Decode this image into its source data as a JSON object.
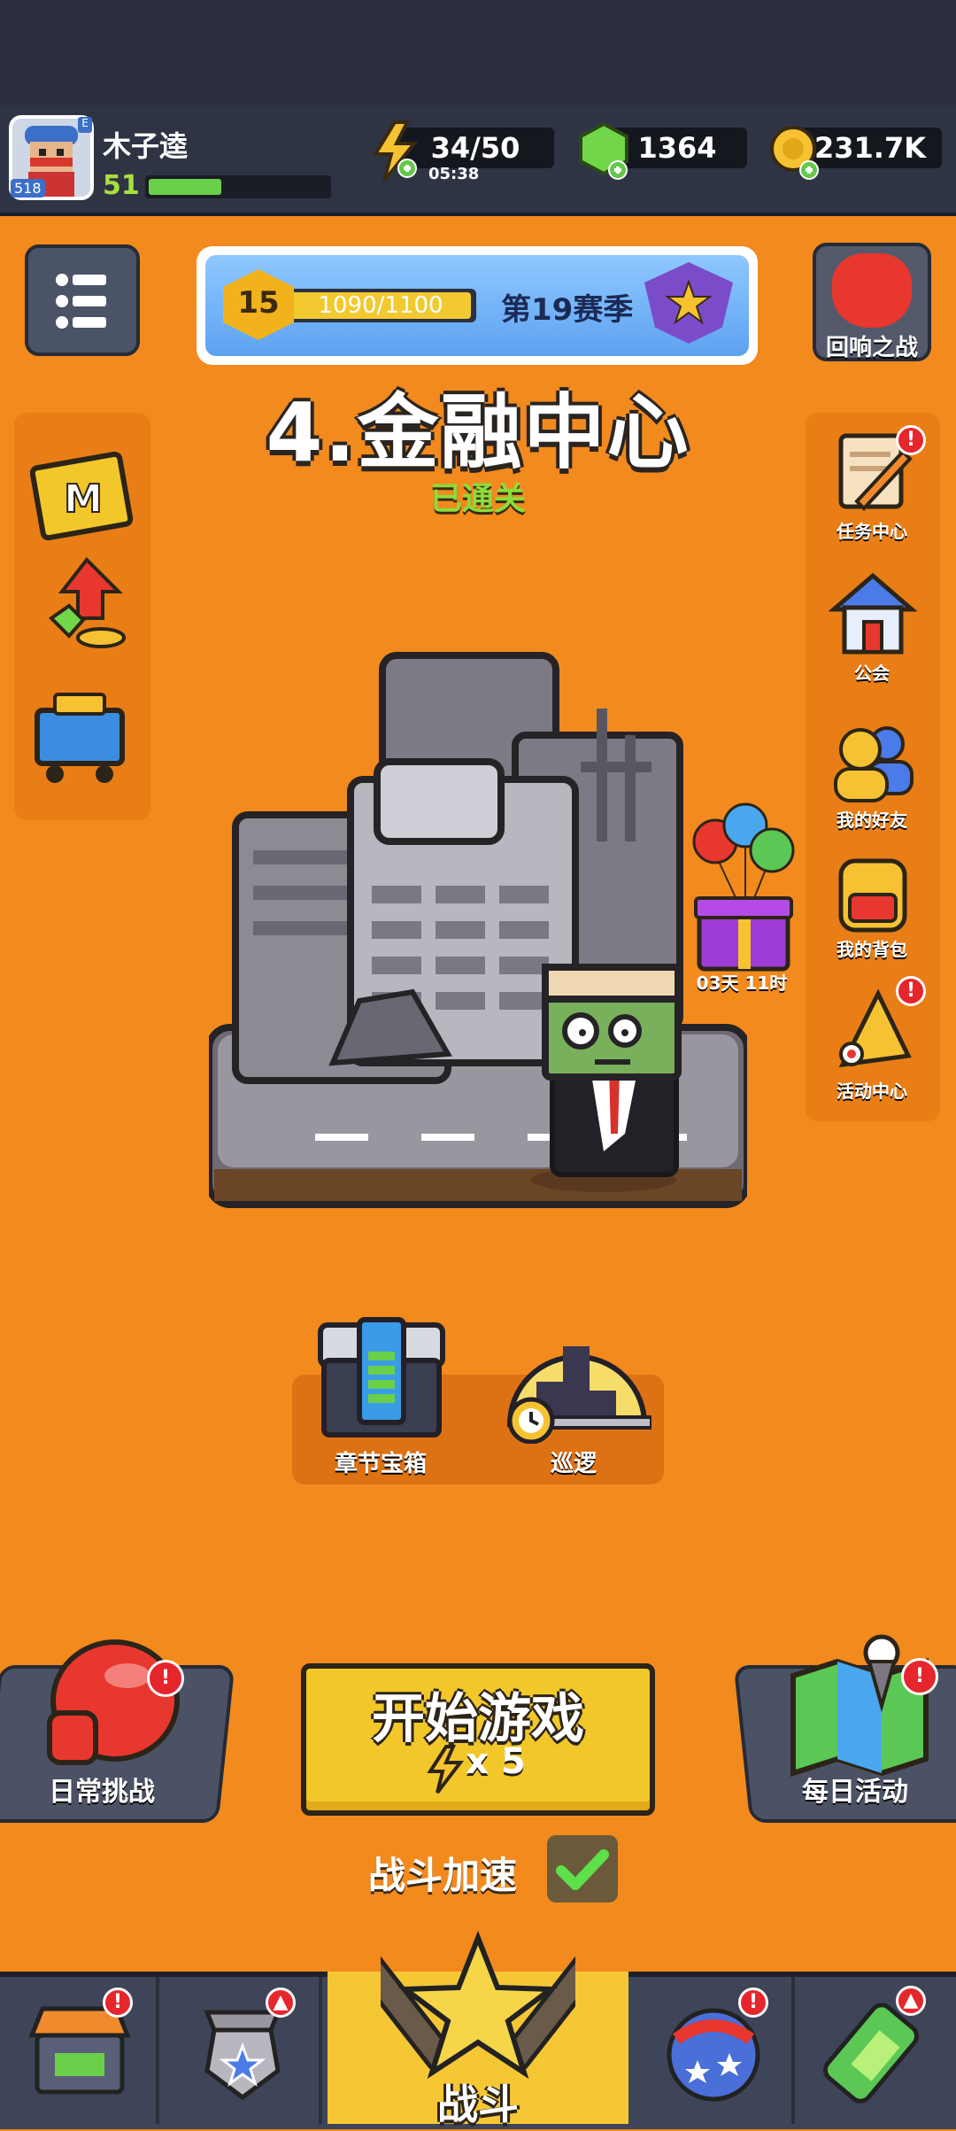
{
  "player": {
    "name": "木子逵",
    "level": "51",
    "avatar_badge": "518",
    "avatar_tag": "E"
  },
  "resources": {
    "energy": "34/50",
    "energy_timer": "05:38",
    "gems": "1364",
    "gold": "231.7K"
  },
  "season": {
    "rank": "15",
    "progress_text": "1090/1100",
    "progress": 0.991,
    "name": "第19赛季"
  },
  "echo_battle": {
    "label": "回响之战"
  },
  "chapter": {
    "title": "4.金融中心",
    "status": "已通关"
  },
  "left_side": {
    "items": [
      {
        "name": "m-card-icon",
        "letter": "M"
      },
      {
        "name": "growth-icon"
      },
      {
        "name": "shop-cart-icon"
      }
    ]
  },
  "right_side": {
    "items": [
      {
        "label": "任务中心",
        "badge": "!"
      },
      {
        "label": "公会",
        "badge": ""
      },
      {
        "label": "我的好友",
        "badge": ""
      },
      {
        "label": "我的背包",
        "badge": ""
      },
      {
        "label": "活动中心",
        "badge": "!"
      }
    ]
  },
  "gift": {
    "timer": "03天 11时"
  },
  "chapter_actions": {
    "chest_label": "章节宝箱",
    "patrol_label": "巡逻"
  },
  "daily_challenge": {
    "label": "日常挑战",
    "badge": "!"
  },
  "daily_activity": {
    "label": "每日活动",
    "badge": "!"
  },
  "start_game": {
    "label": "开始游戏",
    "cost": "x 5"
  },
  "battle_speed": {
    "label": "战斗加速",
    "checked": true
  },
  "nav": {
    "active_label": "战斗",
    "items": [
      {
        "name": "nav-shop",
        "badge": "!"
      },
      {
        "name": "nav-gear",
        "badge": "▲"
      },
      {
        "name": "nav-battle"
      },
      {
        "name": "nav-orbs",
        "badge": "!"
      },
      {
        "name": "nav-gene",
        "badge": "▲"
      }
    ]
  },
  "colors": {
    "background": "#f28a1e",
    "button_yellow": "#f2c72a",
    "cleared_green": "#8cdc3a",
    "badge_red": "#e6262d"
  }
}
